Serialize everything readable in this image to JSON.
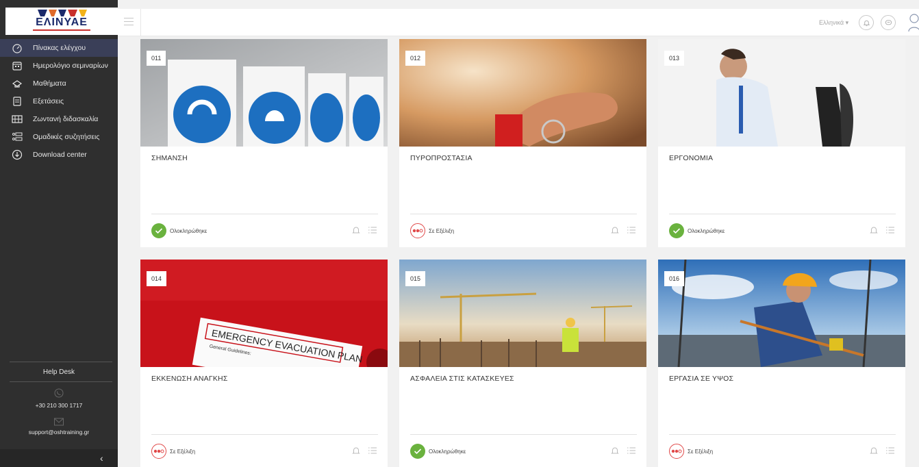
{
  "brand": {
    "name": "ΕΛΙΝΥΑΕ"
  },
  "sidebar": {
    "items": [
      {
        "label": "Πίνακας ελέγχου",
        "icon": "dashboard-icon"
      },
      {
        "label": "Ημερολόγιο σεμιναρίων",
        "icon": "calendar-icon"
      },
      {
        "label": "Μαθήματα",
        "icon": "courses-icon"
      },
      {
        "label": "Εξετάσεις",
        "icon": "exams-icon"
      },
      {
        "label": "Ζωντανή διδασκαλία",
        "icon": "live-teaching-icon"
      },
      {
        "label": "Ομαδικές συζητήσεις",
        "icon": "group-discussion-icon"
      },
      {
        "label": "Download center",
        "icon": "download-icon"
      }
    ],
    "help": {
      "title": "Help Desk",
      "phone": "+30 210 300 1717",
      "email": "support@oshtraining.gr"
    },
    "collapse_label": "‹"
  },
  "header": {
    "language": "Ελληνικά ▾",
    "notifications_icon": "bell-icon",
    "messages_icon": "chat-icon",
    "user_icon": "user-avatar-icon"
  },
  "cards": [
    {
      "code": "011",
      "title": "ΣΗΜΑΝΣΗ",
      "status": "Ολοκληρώθηκε",
      "state": "done"
    },
    {
      "code": "012",
      "title": "ΠΥΡΟΠΡΟΣΤΑΣΙΑ",
      "status": "Σε Εξέλιξη",
      "state": "progress"
    },
    {
      "code": "013",
      "title": "ΕΡΓΟΝΟΜΙΑ",
      "status": "Ολοκληρώθηκε",
      "state": "done"
    },
    {
      "code": "014",
      "title": "ΕΚΚΕΝΩΣΗ ΑΝΑΓΚΗΣ",
      "status": "Σε Εξέλιξη",
      "state": "progress",
      "image_text_line1": "EMERGENCY EVACUATION PLAN",
      "image_text_line2": "General Guidelines:"
    },
    {
      "code": "015",
      "title": "ΑΣΦΑΛΕΙΑ ΣΤΙΣ ΚΑΤΑΣΚΕΥΕΣ",
      "status": "Ολοκληρώθηκε",
      "state": "done"
    },
    {
      "code": "016",
      "title": "ΕΡΓΑΣΙΑ ΣΕ ΥΨΟΣ",
      "status": "Σε Εξέλιξη",
      "state": "progress"
    }
  ],
  "colors": {
    "sidebar_bg": "#2f2f2f",
    "active_item_bg": "#3a3f58",
    "done_green": "#6ab23e",
    "progress_red": "#e04848",
    "brand_navy": "#1b2a6b"
  }
}
